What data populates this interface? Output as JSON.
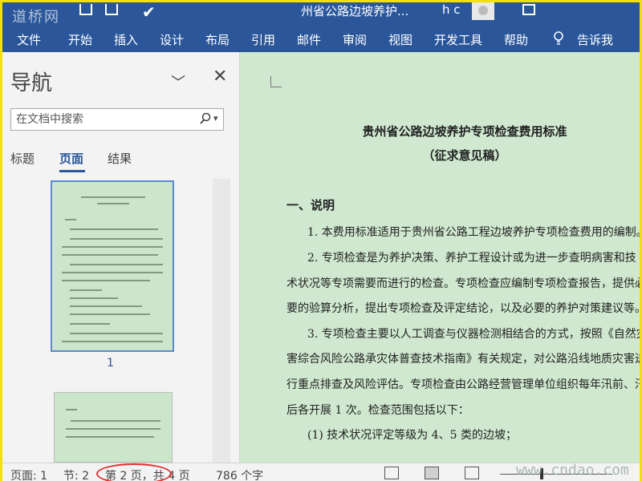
{
  "titlebar": {
    "watermark": "道桥网",
    "doc_title": "州省公路边坡养护...",
    "user": "h c"
  },
  "ribbon": {
    "tabs": [
      "文件",
      "开始",
      "插入",
      "设计",
      "布局",
      "引用",
      "邮件",
      "审阅",
      "视图",
      "开发工具",
      "帮助",
      "告诉我"
    ]
  },
  "nav": {
    "title": "导航",
    "search_placeholder": "在文档中搜索",
    "tabs": [
      "标题",
      "页面",
      "结果"
    ],
    "active_tab": "页面",
    "page_number": "1"
  },
  "document": {
    "title": "贵州省公路边坡养护专项检查费用标准",
    "subtitle": "（征求意见稿）",
    "section_heading": "一、说明",
    "lines": [
      "1. 本费用标准适用于贵州省公路工程边坡养护专项检查费用的编制。",
      "2. 专项检查是为养护决策、养护工程设计或为进一步查明病害和技",
      "术状况等专项需要而进行的检查。专项检查应编制专项检查报告，提供必",
      "要的验算分析，提出专项检查及评定结论，以及必要的养护对策建议等。",
      "3. 专项检查主要以人工调查与仪器检测相结合的方式，按照《自然灾",
      "害综合风险公路承灾体普查技术指南》有关规定，对公路沿线地质灾害进",
      "行重点排查及风险评估。专项检查由公路经营管理单位组织每年汛前、汛",
      "后各开展 1 次。检查范围包括以下：",
      "(1) 技术状况评定等级为 4、5 类的边坡；"
    ]
  },
  "statusbar": {
    "page": "页面: 1",
    "section": "节: 2",
    "current_page": "第 2 页，共 4 页",
    "word_count": "786 个字",
    "watermark": "www.cndao.com"
  }
}
